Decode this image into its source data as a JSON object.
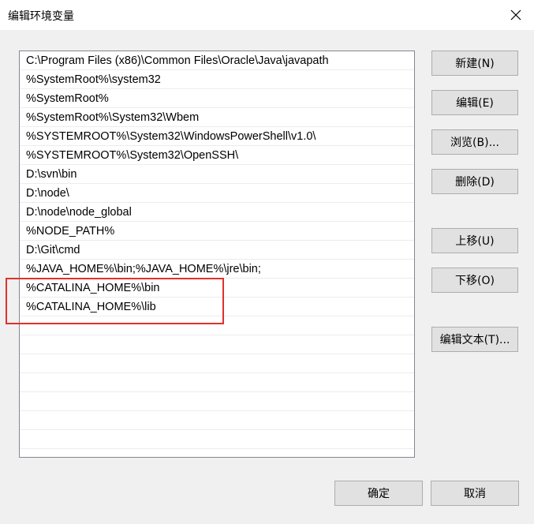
{
  "window": {
    "title": "编辑环境变量",
    "close_label": "✕"
  },
  "paths": [
    "C:\\Program Files (x86)\\Common Files\\Oracle\\Java\\javapath",
    "%SystemRoot%\\system32",
    "%SystemRoot%",
    "%SystemRoot%\\System32\\Wbem",
    "%SYSTEMROOT%\\System32\\WindowsPowerShell\\v1.0\\",
    "%SYSTEMROOT%\\System32\\OpenSSH\\",
    "D:\\svn\\bin",
    "D:\\node\\",
    "D:\\node\\node_global",
    "%NODE_PATH%",
    "D:\\Git\\cmd",
    "%JAVA_HOME%\\bin;%JAVA_HOME%\\jre\\bin;",
    "%CATALINA_HOME%\\bin",
    "%CATALINA_HOME%\\lib"
  ],
  "empty_row_count": 8,
  "buttons": {
    "new": "新建(N)",
    "edit": "编辑(E)",
    "browse": "浏览(B)...",
    "delete": "删除(D)",
    "move_up": "上移(U)",
    "move_down": "下移(O)",
    "edit_text": "编辑文本(T)...",
    "ok": "确定",
    "cancel": "取消"
  },
  "colors": {
    "highlight_box": "#e0312b",
    "dialog_bg": "#f0f0f0",
    "button_bg": "#e1e1e1"
  }
}
